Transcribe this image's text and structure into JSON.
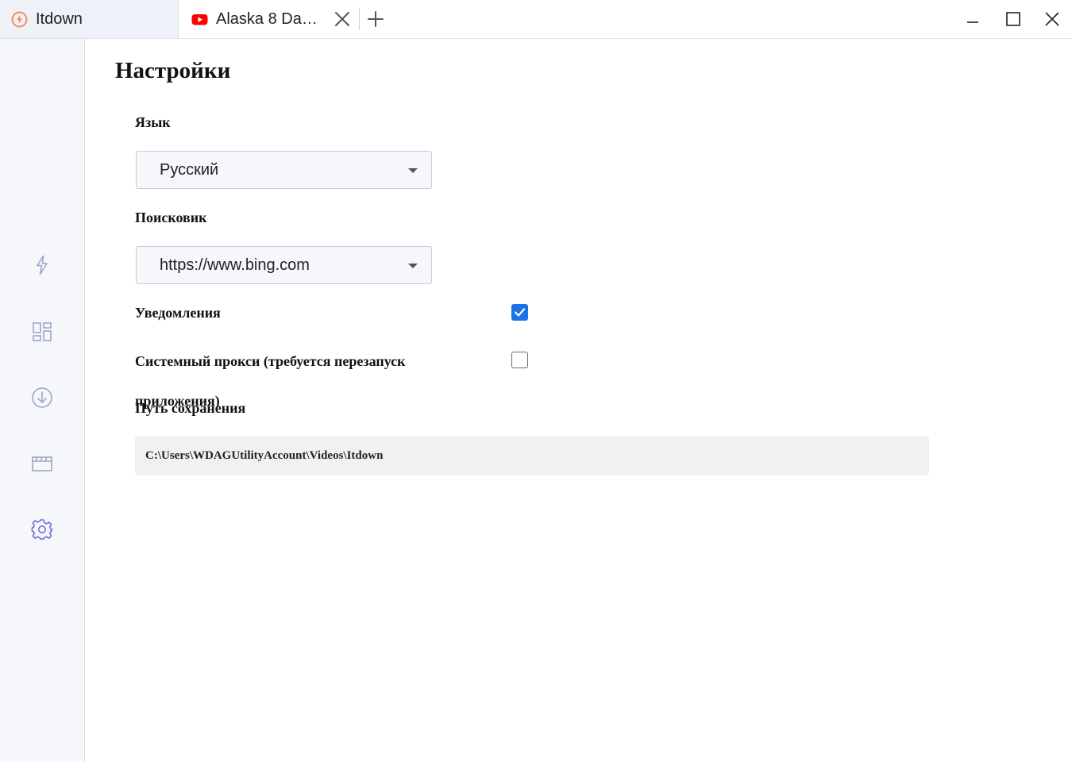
{
  "tabs": [
    {
      "label": "Itdown",
      "icon": "app-logo-icon",
      "active": true
    },
    {
      "label": "Alaska 8 Days...",
      "icon": "youtube-icon",
      "active": false
    }
  ],
  "window_controls": [
    "minimize-icon",
    "maximize-icon",
    "close-icon"
  ],
  "sidebar": {
    "items": [
      {
        "icon": "lightning-icon",
        "active": false
      },
      {
        "icon": "grid-icon",
        "active": false
      },
      {
        "icon": "download-icon",
        "active": false
      },
      {
        "icon": "clapperboard-icon",
        "active": false
      },
      {
        "icon": "gear-icon",
        "active": true
      }
    ]
  },
  "settings": {
    "title": "Настройки",
    "language": {
      "label": "Язык",
      "value": "Русский"
    },
    "search_engine": {
      "label": "Поисковик",
      "value": "https://www.bing.com"
    },
    "notifications": {
      "label": "Уведомления",
      "checked": true
    },
    "system_proxy": {
      "label": "Системный прокси (требуется перезапуск приложения)",
      "checked": false
    },
    "save_path": {
      "label": "Путь сохранения",
      "value": "C:\\Users\\WDAGUtilityAccount\\Videos\\Itdown"
    }
  },
  "colors": {
    "accent": "#1a73e8",
    "app_logo": "#f0834f",
    "youtube": "#ff0000",
    "sidebar_icon": "#9ea6c4",
    "sidebar_icon_active": "#6b6fe0",
    "sidebar_bg": "#f6f7fb"
  }
}
